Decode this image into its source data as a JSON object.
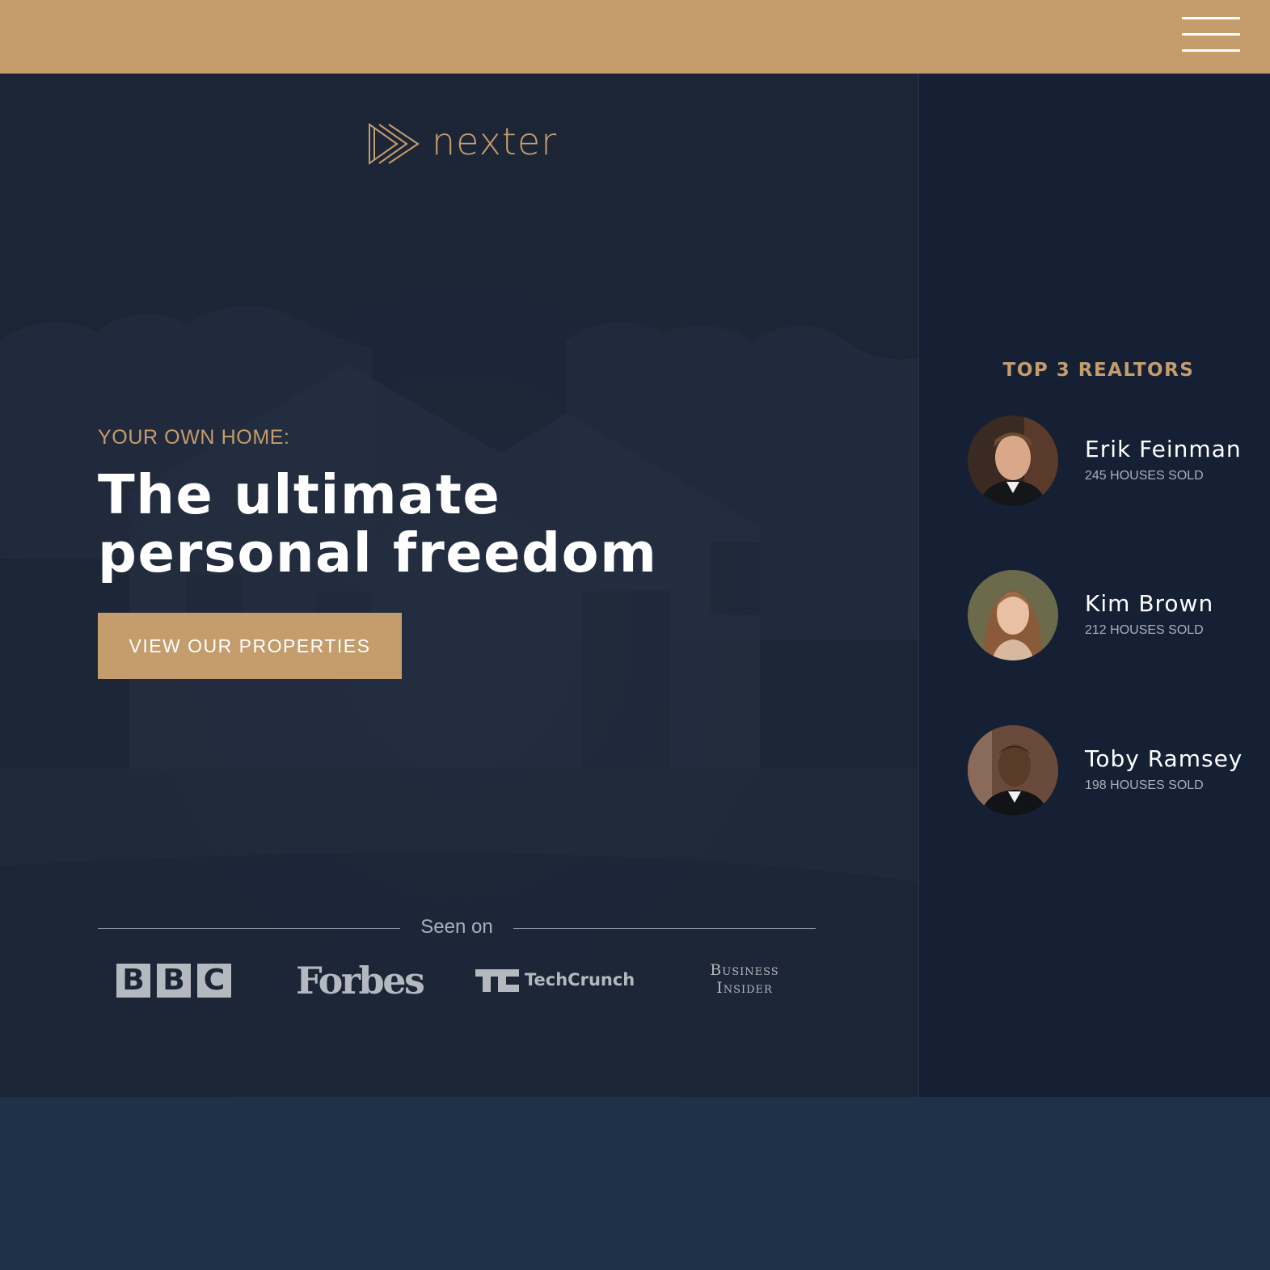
{
  "header": {
    "menu_icon": "hamburger-menu-icon",
    "colors": {
      "bar": "#c59d6c"
    }
  },
  "hero": {
    "logo_text": "nexter",
    "logo_icon": "triple-play-logo-icon",
    "eyebrow": "YOUR OWN HOME:",
    "headline": "The ultimate personal freedom",
    "cta_label": "VIEW OUR PROPERTIES",
    "seen_on_label": "Seen on",
    "press": {
      "bbc": [
        "B",
        "B",
        "C"
      ],
      "forbes": "Forbes",
      "techcrunch": "TechCrunch",
      "business_insider": [
        "Business",
        "Insider"
      ]
    }
  },
  "realtors": {
    "title": "TOP 3 REALTORS",
    "items": [
      {
        "name": "Erik Feinman",
        "sold": "245 HOUSES SOLD"
      },
      {
        "name": "Kim Brown",
        "sold": "212 HOUSES SOLD"
      },
      {
        "name": "Toby Ramsey",
        "sold": "198 HOUSES SOLD"
      }
    ]
  },
  "colors": {
    "accent": "#c59d6c",
    "hero_bg": "#1c2536",
    "sidebar_bg": "#152035",
    "footer_bg": "#1f3049"
  }
}
